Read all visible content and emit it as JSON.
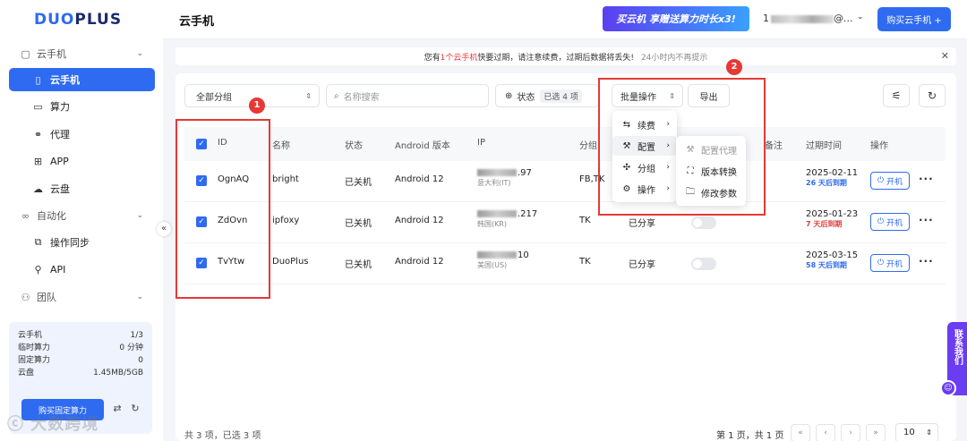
{
  "brand": {
    "logo_a": "DUO",
    "logo_b": "PLUS"
  },
  "sidebar": {
    "group_cloud": "云手机",
    "items": [
      {
        "label": "云手机",
        "icon": "phone-icon"
      },
      {
        "label": "算力",
        "icon": "monitor-icon"
      },
      {
        "label": "代理",
        "icon": "network-icon"
      },
      {
        "label": "APP",
        "icon": "grid-icon"
      },
      {
        "label": "云盘",
        "icon": "cloud-icon"
      }
    ],
    "group_auto": "自动化",
    "auto_items": [
      {
        "label": "操作同步",
        "icon": "sync-icon"
      },
      {
        "label": "API",
        "icon": "api-icon"
      }
    ],
    "group_team": "团队"
  },
  "quota": {
    "rows": [
      {
        "label": "云手机",
        "value": "1/3"
      },
      {
        "label": "临时算力",
        "value": "0 分钟"
      },
      {
        "label": "固定算力",
        "value": "0"
      },
      {
        "label": "云盘",
        "value": "1.45MB/5GB"
      }
    ],
    "buy_label": "购买固定算力"
  },
  "watermark": "大数跨境",
  "header": {
    "title": "云手机",
    "promo": "买云机 享赠送算力时长x3!",
    "account_prefix": "1",
    "account_suffix": "@...",
    "buy_label": "购买云手机 +"
  },
  "notice": {
    "pre": "您有",
    "highlight": "1个云手机",
    "post": "快要过期，请注意续费，过期后数据将丢失!",
    "mute": "24小时内不再提示"
  },
  "toolbar": {
    "group_select": "全部分组",
    "search_placeholder": "名称搜索",
    "status_label": "状态",
    "status_tag": "已选 4 项",
    "batch_label": "批量操作",
    "export_label": "导出"
  },
  "table": {
    "headers": {
      "id": "ID",
      "name": "名称",
      "status": "状态",
      "android": "Android 版本",
      "ip": "IP",
      "group": "分组",
      "remark": "备注",
      "expire": "过期时间",
      "op": "操作"
    },
    "rows": [
      {
        "id": "OgnAQ",
        "name": "bright",
        "status": "已关机",
        "android": "Android 12",
        "ip_tail": ".97",
        "ip_region": "意大利(IT)",
        "group": "FB,TK",
        "share": "",
        "expire": "2025-02-11",
        "expire_note": "26 天后到期",
        "expire_bad": false
      },
      {
        "id": "ZdOvn",
        "name": "ipfoxy",
        "status": "已关机",
        "android": "Android 12",
        "ip_tail": ".217",
        "ip_region": "韩国(KR)",
        "group": "TK",
        "share": "已分享",
        "expire": "2025-01-23",
        "expire_note": "7 天后到期",
        "expire_bad": true
      },
      {
        "id": "TvYtw",
        "name": "DuoPlus",
        "status": "已关机",
        "android": "Android 12",
        "ip_tail": "10",
        "ip_region": "美国(US)",
        "group": "TK",
        "share": "已分享",
        "expire": "2025-03-15",
        "expire_note": "58 天后到期",
        "expire_bad": false
      }
    ],
    "power_label": "开机"
  },
  "batch_menu": {
    "items": [
      {
        "label": "续费",
        "icon": "renew-icon"
      },
      {
        "label": "配置",
        "icon": "wrench-icon"
      },
      {
        "label": "分组",
        "icon": "group-icon"
      },
      {
        "label": "操作",
        "icon": "gear-icon"
      }
    ],
    "sub_items": [
      {
        "label": "配置代理",
        "icon": "wrench-icon",
        "disabled": true
      },
      {
        "label": "版本转换",
        "icon": "convert-icon",
        "disabled": false
      },
      {
        "label": "修改参数",
        "icon": "folder-edit-icon",
        "disabled": false
      }
    ]
  },
  "annotations": {
    "badge_1": "1",
    "badge_2": "2"
  },
  "footer": {
    "summary": "共 3 项，已选 3 项",
    "page_info": "第 1 页，共 1 页",
    "page_size": "10"
  },
  "contact": "联系我们",
  "colors": {
    "primary": "#2f6bf0",
    "danger": "#e23b3b",
    "annotation": "#e53935",
    "contact": "#6a3cf2"
  }
}
